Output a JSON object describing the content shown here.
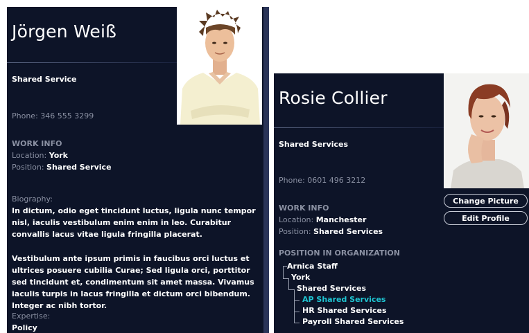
{
  "profile1": {
    "name": "Jörgen Weiß",
    "department": "Shared Service",
    "phone_label": "Phone:",
    "phone": "346 555 3299",
    "work_info_heading": "WORK INFO",
    "location_label": "Location:",
    "location": "York",
    "position_label": "Position:",
    "position": "Shared Service",
    "biography_label": "Biography:",
    "biography_p1": "In dictum, odio eget tincidunt luctus, ligula nunc tempor nisl, iaculis vestibulum enim enim in leo. Curabitur convallis lacus vitae ligula fringilla placerat.",
    "biography_p2": "Vestibulum ante ipsum primis in faucibus orci luctus et ultrices posuere cubilia Curae; Sed ligula orci, porttitor sed tincidunt et, condimentum sit amet massa. Vivamus iaculis turpis in lacus fringilla et dictum orci bibendum. Integer ac nibh tortor.",
    "expertise_label": "Expertise:",
    "expertise": "Policy"
  },
  "profile2": {
    "name": "Rosie Collier",
    "department": "Shared Services",
    "phone_label": "Phone:",
    "phone": "0601 496 3212",
    "work_info_heading": "WORK INFO",
    "location_label": "Location:",
    "location": "Manchester",
    "position_label": "Position:",
    "position": "Shared Services",
    "org_heading": "POSITION IN ORGANIZATION",
    "org_tree": [
      "Arnica Staff",
      "York",
      "Shared Services",
      "AP Shared Services",
      "HR Shared Services",
      "Payroll Shared Services"
    ],
    "change_picture_label": "Change Picture",
    "edit_profile_label": "Edit Profile"
  },
  "colors": {
    "card_bg": "#0d1428",
    "label": "#8a90a2",
    "selected_node": "#1fc6d3",
    "scroll_edge": "#2a3458"
  }
}
